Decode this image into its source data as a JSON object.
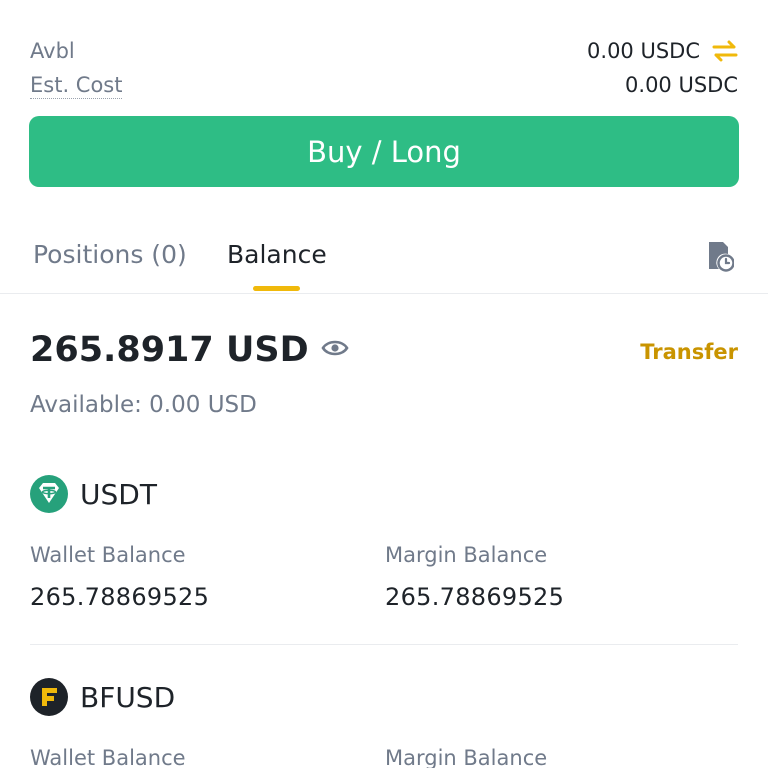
{
  "order": {
    "avbl_label": "Avbl",
    "avbl_value": "0.00 USDC",
    "cost_label": "Est. Cost",
    "cost_value": "0.00 USDC",
    "buy_label": "Buy / Long"
  },
  "tabs": {
    "positions_label": "Positions (0)",
    "balance_label": "Balance",
    "active": "Balance"
  },
  "balance": {
    "total": "265.8917 USD",
    "transfer_label": "Transfer",
    "available": "Available: 0.00 USD"
  },
  "assets": [
    {
      "name": "USDT",
      "icon": "tether-icon",
      "wallet_label": "Wallet Balance",
      "wallet_value": "265.78869525",
      "margin_label": "Margin Balance",
      "margin_value": "265.78869525"
    },
    {
      "name": "BFUSD",
      "icon": "bfusd-icon",
      "wallet_label": "Wallet Balance",
      "margin_label": "Margin Balance"
    }
  ],
  "colors": {
    "buy": "#2ebd85",
    "accent": "#f0b90b",
    "transfer": "#c99400",
    "tether": "#26a17b"
  }
}
